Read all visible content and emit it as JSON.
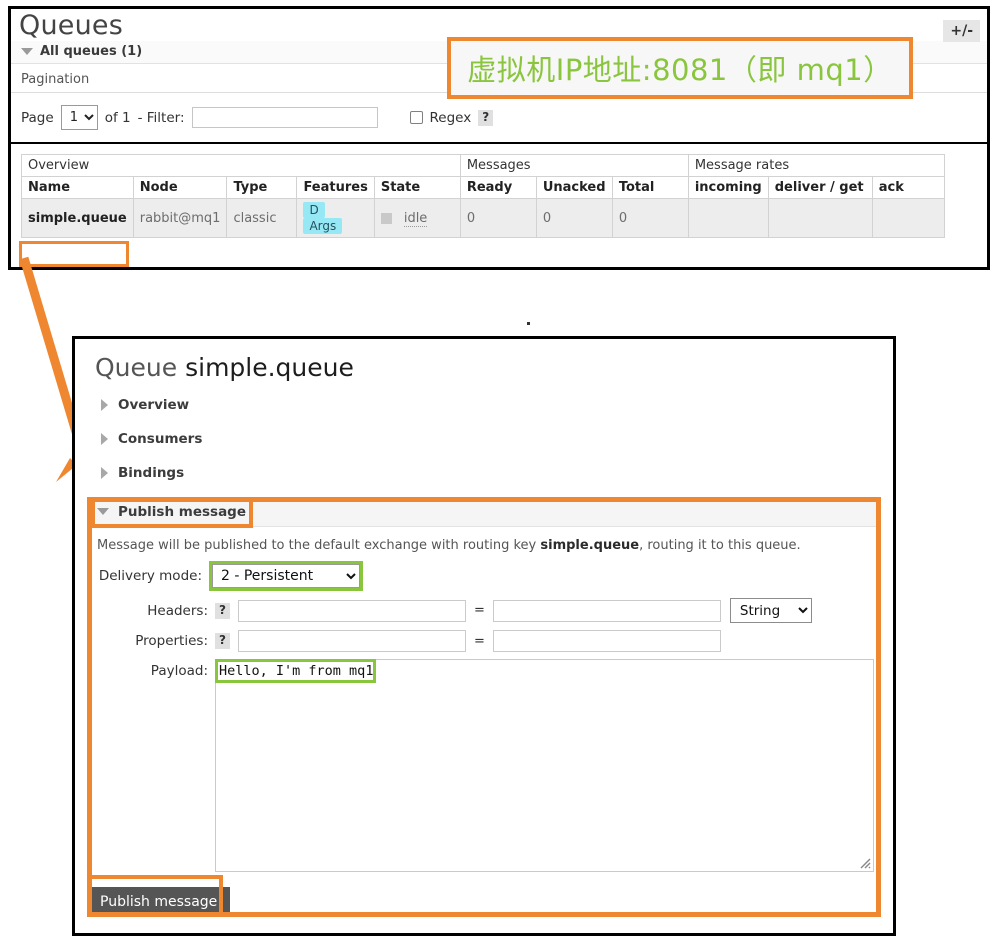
{
  "queues_panel": {
    "title": "Queues",
    "all_queues_label": "All queues (1)",
    "pagination_label": "Pagination",
    "pagination": {
      "page_label": "Page",
      "page_value": "1",
      "of_label": "of 1",
      "filter_label": "- Filter:",
      "filter_value": "",
      "regex_label": "Regex",
      "help_label": "?"
    },
    "table": {
      "group_headers": {
        "overview": "Overview",
        "messages": "Messages",
        "message_rates": "Message rates"
      },
      "columns": [
        "Name",
        "Node",
        "Type",
        "Features",
        "State",
        "Ready",
        "Unacked",
        "Total",
        "incoming",
        "deliver / get",
        "ack"
      ],
      "rows": [
        {
          "name": "simple.queue",
          "node": "rabbit@mq1",
          "type": "classic",
          "features": [
            "D",
            "Args"
          ],
          "state": "idle",
          "ready": "0",
          "unacked": "0",
          "total": "0",
          "incoming": "",
          "deliver_get": "",
          "ack": ""
        }
      ],
      "toggle_columns_label": "+/-"
    }
  },
  "annotation": {
    "ip_note": "虚拟机IP地址:8081（即 mq1）",
    "note_color": "#8ac53e",
    "highlight_color": "#ef8730"
  },
  "queue_panel": {
    "title_prefix": "Queue",
    "title_name": "simple.queue",
    "sections": [
      {
        "label": "Overview"
      },
      {
        "label": "Consumers"
      },
      {
        "label": "Bindings"
      }
    ],
    "publish": {
      "header": "Publish message",
      "routing_prefix": "Message will be published to the default exchange with routing key ",
      "routing_key": "simple.queue",
      "routing_suffix": ", routing it to this queue.",
      "delivery_mode_label": "Delivery mode:",
      "delivery_mode_value": "2 - Persistent",
      "headers_label": "Headers:",
      "headers_help": "?",
      "headers_key": "",
      "headers_value": "",
      "headers_type": "String",
      "properties_label": "Properties:",
      "properties_help": "?",
      "properties_key": "",
      "properties_value": "",
      "payload_label": "Payload:",
      "payload_misspelled": "Hello,",
      "payload_rest": " I'm from mq1",
      "equals": "=",
      "publish_button": "Publish message"
    }
  }
}
